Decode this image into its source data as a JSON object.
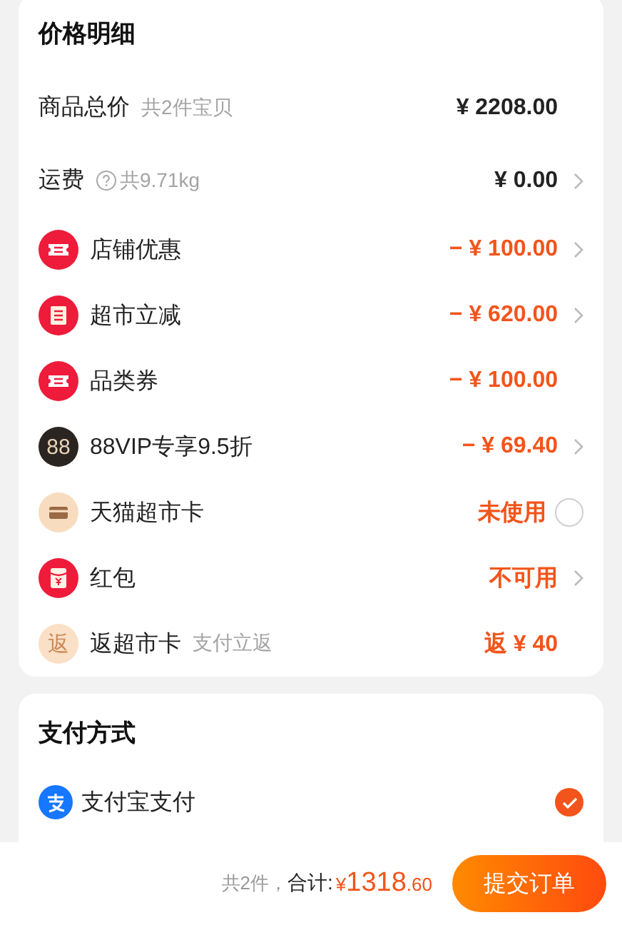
{
  "price_card": {
    "title": "价格明细",
    "rows": [
      {
        "kind": "plain",
        "label": "商品总价",
        "note": "共2件宝贝",
        "value": "¥ 2208.00",
        "highlight": false,
        "expandable": false
      },
      {
        "kind": "help",
        "label": "运费",
        "note": "共9.71kg",
        "value": "¥ 0.00",
        "highlight": false,
        "expandable": true
      },
      {
        "kind": "coupon",
        "label": "店铺优惠",
        "value": "− ¥ 100.00",
        "highlight": true,
        "expandable": true
      },
      {
        "kind": "instant-discount",
        "label": "超市立减",
        "value": "− ¥ 620.00",
        "highlight": true,
        "expandable": true
      },
      {
        "kind": "coupon",
        "label": "品类券",
        "value": "− ¥ 100.00",
        "highlight": true,
        "expandable": false
      },
      {
        "kind": "vip",
        "icon_text": "88",
        "label": "88VIP专享9.5折",
        "value": "− ¥ 69.40",
        "highlight": true,
        "expandable": true
      },
      {
        "kind": "card",
        "label": "天猫超市卡",
        "value": "未使用",
        "highlight": true,
        "selected": false
      },
      {
        "kind": "red-packet",
        "label": "红包",
        "value": "不可用",
        "highlight": true,
        "expandable": true
      },
      {
        "kind": "rebate",
        "icon_text": "返",
        "label": "返超市卡",
        "note": "支付立返",
        "value": "返 ¥ 40",
        "highlight": true,
        "expandable": false
      }
    ]
  },
  "payment": {
    "title": "支付方式",
    "methods": [
      {
        "label": "支付宝支付",
        "selected": true
      }
    ]
  },
  "bottom_bar": {
    "count": "共2件，",
    "total_label": "合计:",
    "currency": "¥",
    "amount": "1318",
    "decimals": ".60",
    "submit": "提交订单"
  }
}
